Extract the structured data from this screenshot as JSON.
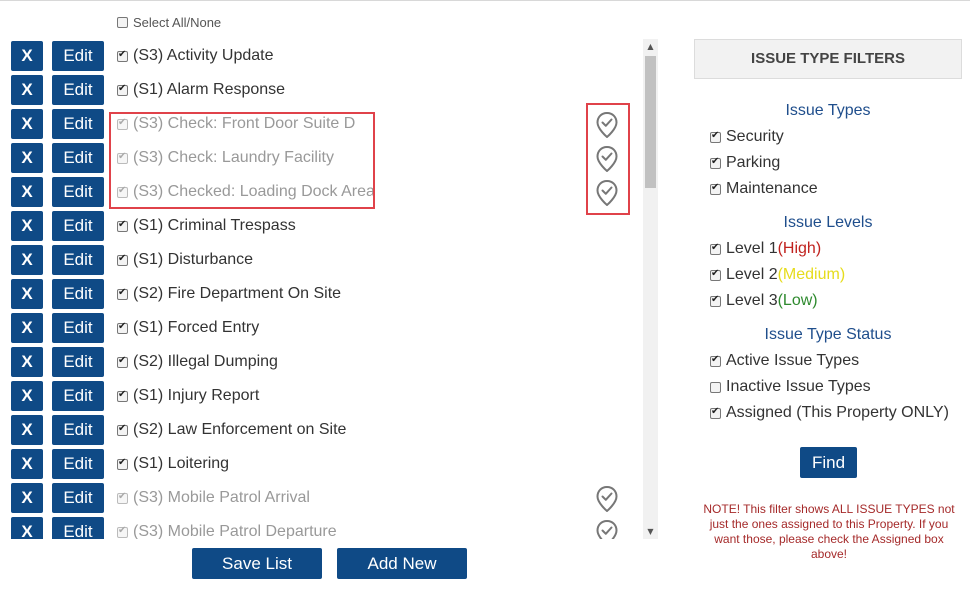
{
  "select_all_label": "Select All/None",
  "colors": {
    "button_bg": "#0f4a86",
    "highlight": "#e0424a",
    "title_blue": "#1f4e8c",
    "note_red": "#a52a2a"
  },
  "rows": [
    {
      "delete_label": "X",
      "edit_label": "Edit",
      "label": "(S3) Activity Update",
      "checked": true,
      "active": true,
      "has_location_icon": false
    },
    {
      "delete_label": "X",
      "edit_label": "Edit",
      "label": "(S1) Alarm Response",
      "checked": true,
      "active": true,
      "has_location_icon": false
    },
    {
      "delete_label": "X",
      "edit_label": "Edit",
      "label": "(S3) Check: Front Door Suite D",
      "checked": true,
      "active": false,
      "has_location_icon": true
    },
    {
      "delete_label": "X",
      "edit_label": "Edit",
      "label": "(S3) Check: Laundry Facility",
      "checked": true,
      "active": false,
      "has_location_icon": true
    },
    {
      "delete_label": "X",
      "edit_label": "Edit",
      "label": "(S3) Checked: Loading Dock Area",
      "checked": true,
      "active": false,
      "has_location_icon": true
    },
    {
      "delete_label": "X",
      "edit_label": "Edit",
      "label": "(S1) Criminal Trespass",
      "checked": true,
      "active": true,
      "has_location_icon": false
    },
    {
      "delete_label": "X",
      "edit_label": "Edit",
      "label": "(S1) Disturbance",
      "checked": true,
      "active": true,
      "has_location_icon": false
    },
    {
      "delete_label": "X",
      "edit_label": "Edit",
      "label": "(S2) Fire Department On Site",
      "checked": true,
      "active": true,
      "has_location_icon": false
    },
    {
      "delete_label": "X",
      "edit_label": "Edit",
      "label": "(S1) Forced Entry",
      "checked": true,
      "active": true,
      "has_location_icon": false
    },
    {
      "delete_label": "X",
      "edit_label": "Edit",
      "label": "(S2) Illegal Dumping",
      "checked": true,
      "active": true,
      "has_location_icon": false
    },
    {
      "delete_label": "X",
      "edit_label": "Edit",
      "label": "(S1) Injury Report",
      "checked": true,
      "active": true,
      "has_location_icon": false
    },
    {
      "delete_label": "X",
      "edit_label": "Edit",
      "label": "(S2) Law Enforcement on Site",
      "checked": true,
      "active": true,
      "has_location_icon": false
    },
    {
      "delete_label": "X",
      "edit_label": "Edit",
      "label": "(S1) Loitering",
      "checked": true,
      "active": true,
      "has_location_icon": false
    },
    {
      "delete_label": "X",
      "edit_label": "Edit",
      "label": "(S3) Mobile Patrol Arrival",
      "checked": true,
      "active": false,
      "has_location_icon": true
    },
    {
      "delete_label": "X",
      "edit_label": "Edit",
      "label": "(S3) Mobile Patrol Departure",
      "checked": true,
      "active": false,
      "has_location_icon": true
    }
  ],
  "buttons": {
    "save_list": "Save List",
    "add_new": "Add New",
    "find": "Find"
  },
  "filters": {
    "header": "ISSUE TYPE FILTERS",
    "issue_types_title": "Issue Types",
    "issue_types": [
      {
        "label": "Security",
        "checked": true
      },
      {
        "label": "Parking",
        "checked": true
      },
      {
        "label": "Maintenance",
        "checked": true
      }
    ],
    "issue_levels_title": "Issue Levels",
    "issue_levels": [
      {
        "label": "Level 1 ",
        "tag": "(High)",
        "checked": true
      },
      {
        "label": "Level 2 ",
        "tag": "(Medium)",
        "checked": true
      },
      {
        "label": "Level 3 ",
        "tag": "(Low)",
        "checked": true
      }
    ],
    "status_title": "Issue Type Status",
    "status": [
      {
        "label": "Active Issue Types",
        "checked": true
      },
      {
        "label": "Inactive Issue Types",
        "checked": false
      },
      {
        "label": "Assigned (This Property ONLY)",
        "checked": true
      }
    ],
    "note": "NOTE! This filter shows ALL ISSUE TYPES not just the ones assigned to this Property. If you want those, please check the Assigned box above!"
  }
}
